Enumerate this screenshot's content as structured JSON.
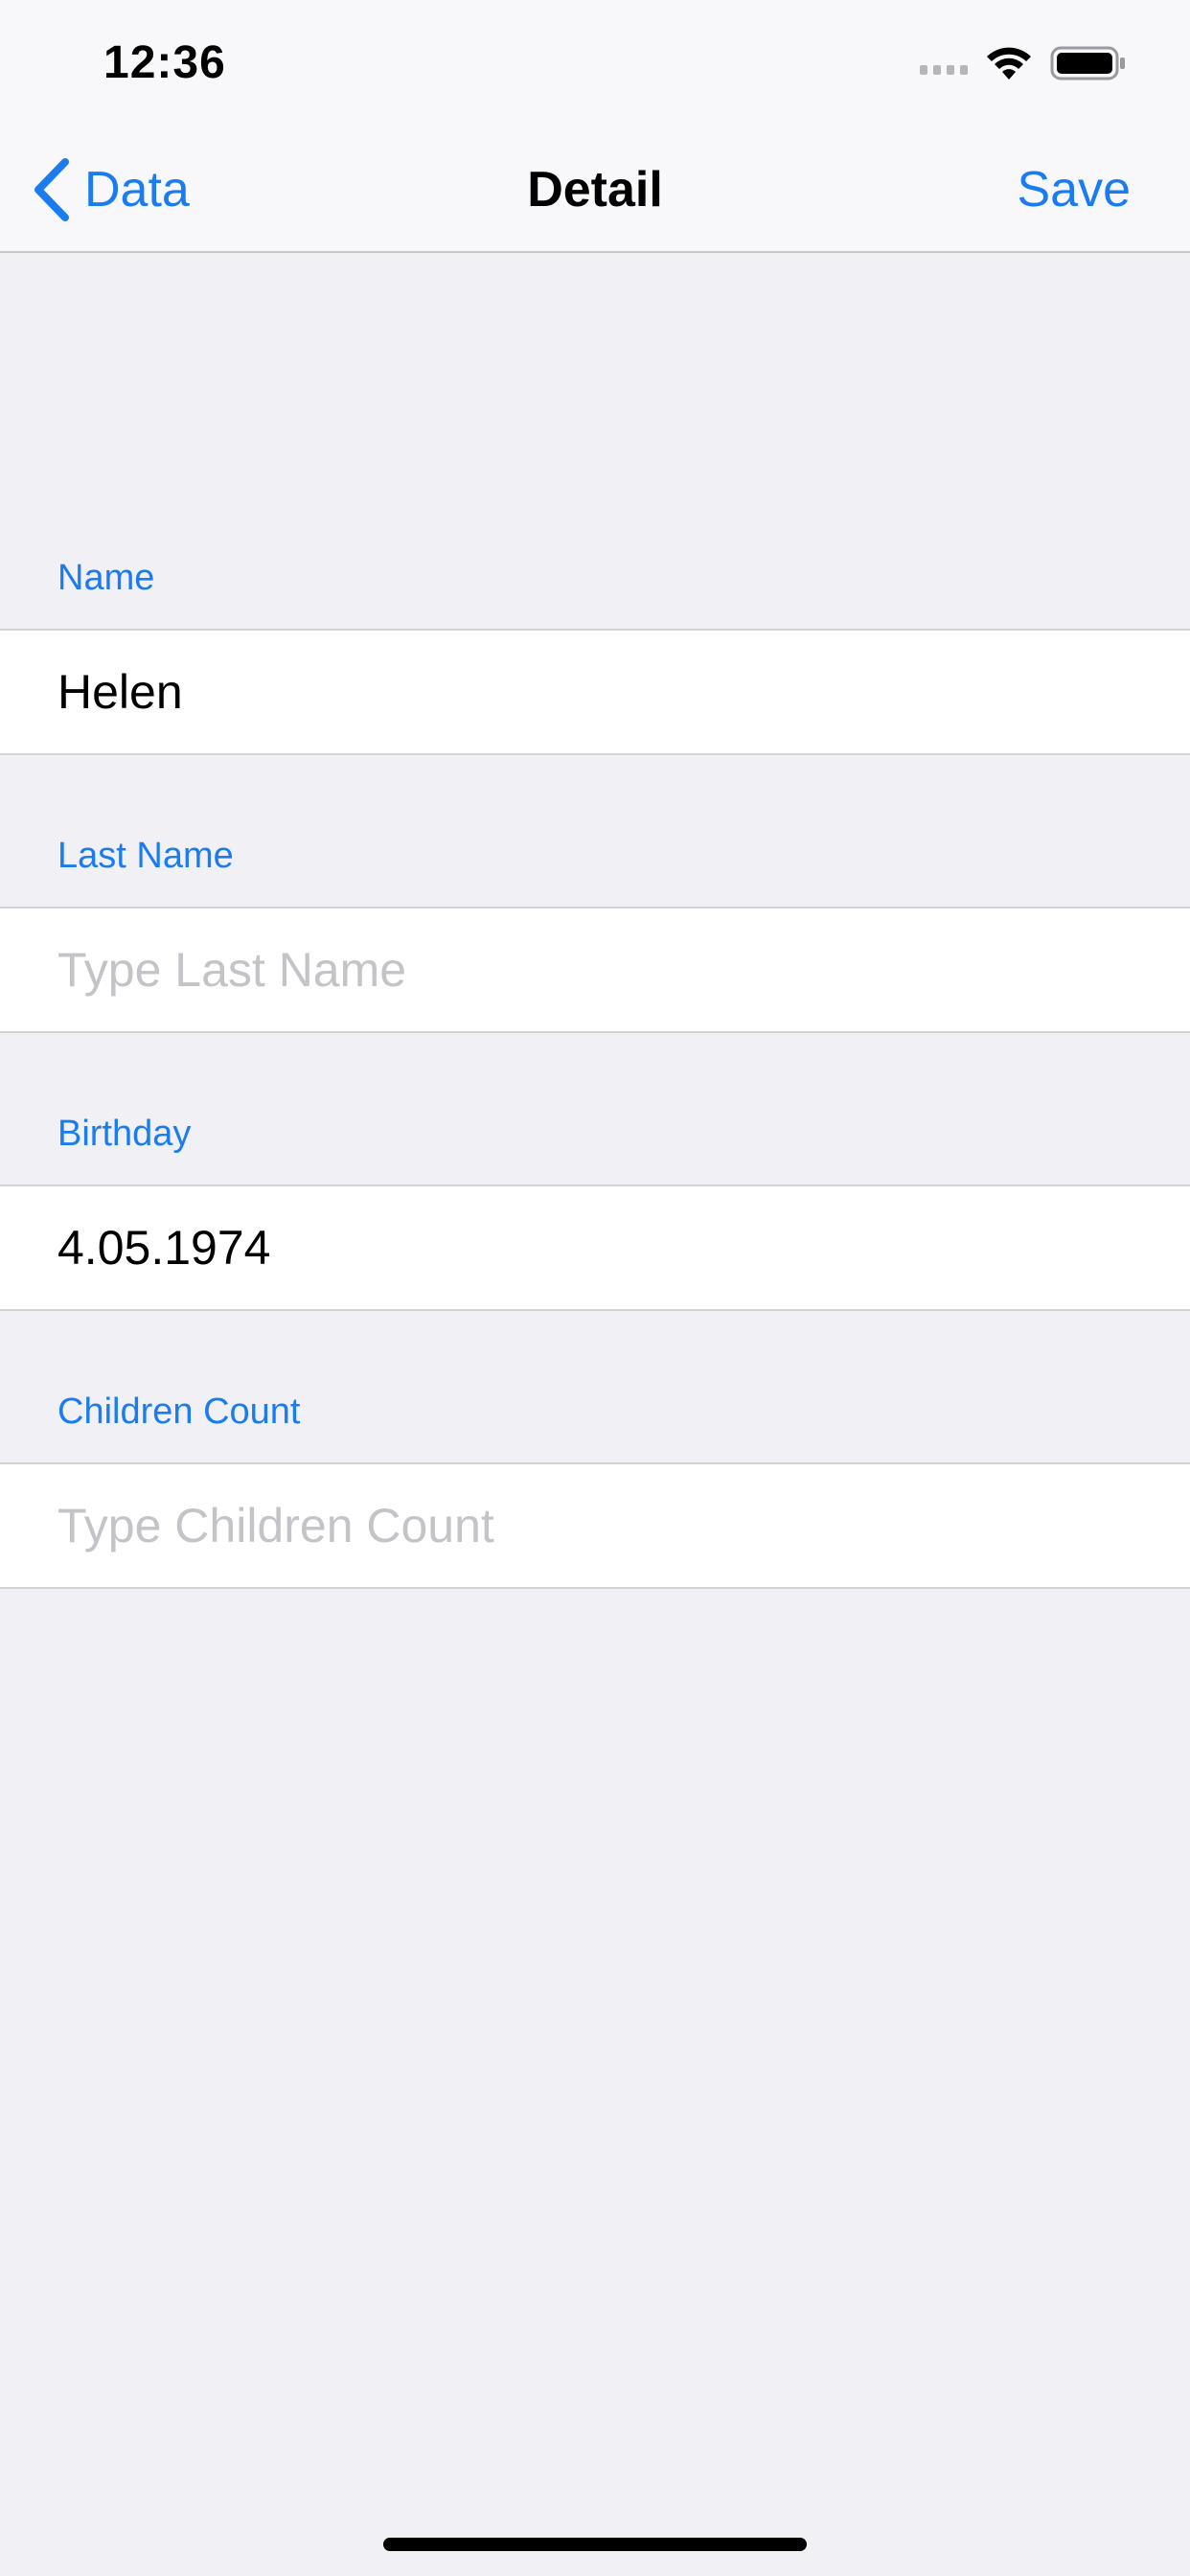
{
  "status_bar": {
    "time": "12:36",
    "icons": [
      "cellular-signal-icon",
      "wifi-icon",
      "battery-icon"
    ]
  },
  "nav": {
    "back_label": "Data",
    "title": "Detail",
    "save_label": "Save",
    "accent_color": "#1a7cf0"
  },
  "form": {
    "name": {
      "header": "Name",
      "value": "Helen",
      "placeholder": ""
    },
    "last_name": {
      "header": "Last Name",
      "value": "",
      "placeholder": "Type Last Name"
    },
    "birthday": {
      "header": "Birthday",
      "value": "4.05.1974",
      "placeholder": ""
    },
    "children_count": {
      "header": "Children Count",
      "value": "",
      "placeholder": "Type Children Count"
    }
  }
}
